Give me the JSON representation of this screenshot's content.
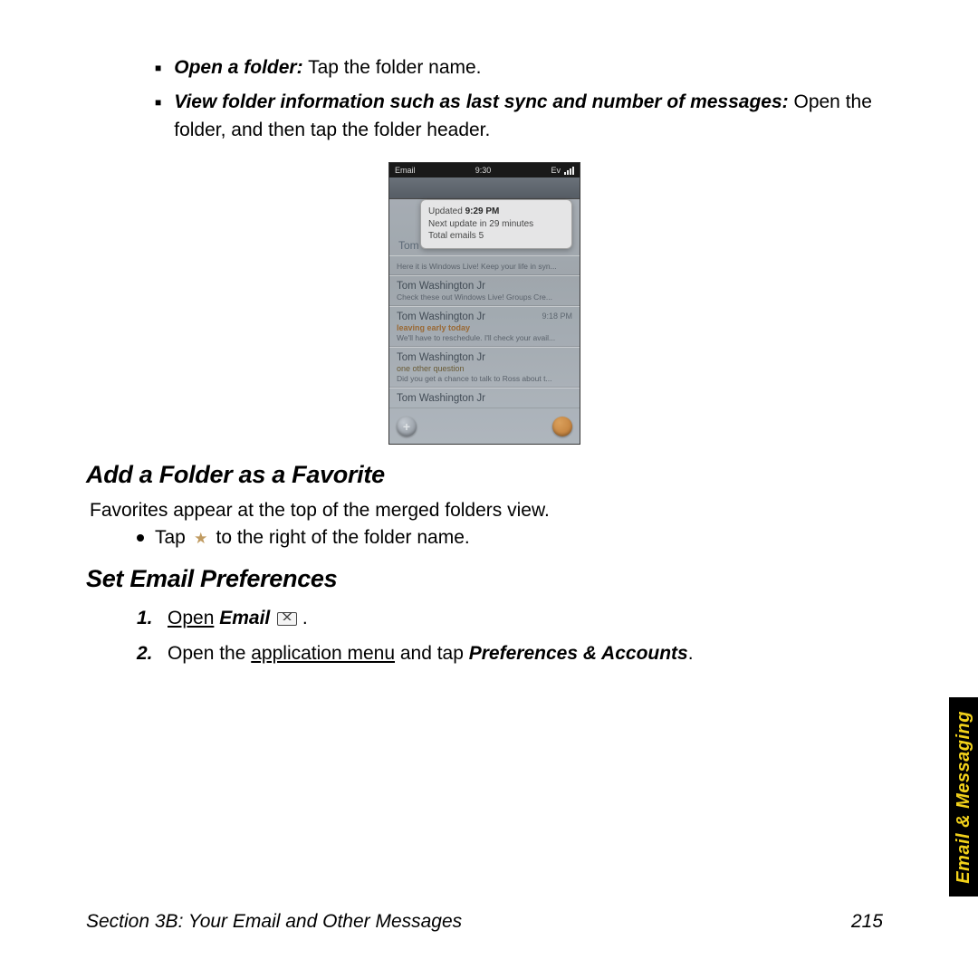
{
  "bullets_top": [
    {
      "label": "Open a folder:",
      "rest": " Tap the folder name."
    },
    {
      "label": "View folder information such as last sync and number of messages:",
      "rest": " Open the folder, and then tap the folder header."
    }
  ],
  "phone": {
    "app_label": "Email",
    "time": "9:30",
    "ev": "Ev",
    "popup": {
      "line1_pre": "Updated ",
      "line1_bold": "9:29 PM",
      "line2": "Next update in 29 minutes",
      "line3": "Total emails 5"
    },
    "behind": "Tom",
    "mails": [
      {
        "from": "",
        "time": "",
        "subject": "",
        "preview": "Here it is Windows Live! Keep your life in syn..."
      },
      {
        "from": "Tom Washington Jr",
        "time": " ",
        "subject": " ",
        "preview": "Check these out Windows Live! Groups Cre..."
      },
      {
        "from": "Tom Washington Jr",
        "time": "9:18 PM",
        "subject": "leaving early today",
        "preview": "We'll have to reschedule. I'll check your avail...",
        "hot": true
      },
      {
        "from": "Tom Washington Jr",
        "time": " ",
        "subject": "one other question",
        "preview": "Did you get a chance to talk to Ross about t..."
      },
      {
        "from": "Tom Washington Jr",
        "time": " ",
        "subject": "",
        "preview": ""
      }
    ]
  },
  "h_fav": "Add a Folder as a Favorite",
  "fav_para": "Favorites appear at the top of the merged folders view.",
  "fav_bullet_pre": "Tap ",
  "fav_bullet_post": " to the right of the folder name.",
  "h_pref": "Set Email Preferences",
  "steps": [
    {
      "num": "1.",
      "segments": [
        {
          "t": "Open",
          "u": true
        },
        {
          "t": " "
        },
        {
          "t": "Email",
          "ib": true
        },
        {
          "t": " "
        },
        {
          "icon": "email"
        },
        {
          "t": " ."
        }
      ]
    },
    {
      "num": "2.",
      "segments": [
        {
          "t": "Open the "
        },
        {
          "t": "application menu",
          "u": true
        },
        {
          "t": " and tap "
        },
        {
          "t": "Preferences & Accounts",
          "ib": true
        },
        {
          "t": "."
        }
      ]
    }
  ],
  "footer": {
    "left": "Section 3B: Your Email and Other Messages",
    "right": "215"
  },
  "side_tab": "Email & Messaging"
}
